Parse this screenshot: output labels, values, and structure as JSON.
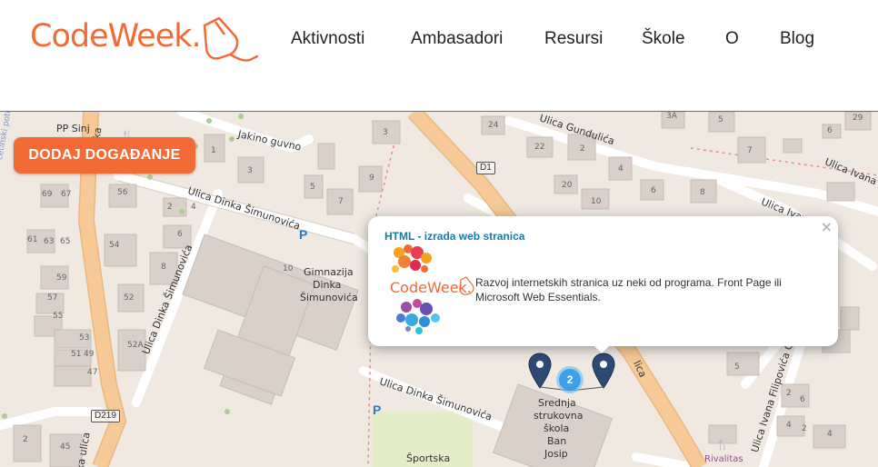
{
  "logo": {
    "text": "CodeWeek."
  },
  "nav": {
    "items": [
      {
        "label": "Aktivnosti"
      },
      {
        "label": "Ambasadori"
      },
      {
        "label": "Resursi"
      },
      {
        "label": "Škole"
      },
      {
        "label": "O"
      },
      {
        "label": "Blog"
      }
    ]
  },
  "map": {
    "add_event_button": "DODAJ DOGAĐANJE",
    "popup": {
      "title": "HTML - izrada web stranica",
      "description": "Razvoj internetskih stranica uz neki od programa. Front Page ili Microsoft Web Essentials.",
      "close": "×",
      "image_text": "CodeWeek."
    },
    "cluster_count": "2",
    "labels": {
      "pp_sinj": "PP Sinj",
      "jakino_guvno": "Jakino guvno",
      "gimnazija_1": "Gimnazija",
      "gimnazija_2": "Dinka",
      "gimnazija_3": "Šimunovića",
      "srednja_1": "Srednja",
      "srednja_2": "strukovna",
      "srednja_3": "škola",
      "srednja_4": "Ban",
      "srednja_5": "Josip",
      "sportska": "Športska",
      "rivalitas": "Rivalitas",
      "street_dinka_1": "Ulica Dinka Šimunovića",
      "street_dinka_2": "Ulica Dinka Šimunovića",
      "street_dinka_3": "Ulica Dinka Šimunovića",
      "street_dinka_vertical": "Ulica Dinka Šimunovića",
      "street_gundulica": "Ulica Gundulića",
      "street_ivana_a": "Ulica Ivana A",
      "street_ivana": "Ulica Ivan",
      "street_ivana_filipovica": "Ulica Ivana Filipovića Gr",
      "street_ka_ulica": "ka ulica",
      "street_rlicka": "rlička",
      "street_lica": "lica",
      "road_d1": "D1",
      "road_d219": "D219",
      "parking": "P",
      "cetinski_potok": "cetinski potok"
    },
    "house_numbers": [
      "3",
      "24",
      "3A",
      "5",
      "29",
      "22",
      "2",
      "7",
      "6",
      "1",
      "3",
      "5",
      "9",
      "7",
      "4",
      "20",
      "10",
      "6",
      "8",
      "56",
      "69",
      "67",
      "2",
      "4",
      "61",
      "63",
      "65",
      "54",
      "6",
      "8",
      "59",
      "57",
      "55",
      "52",
      "52A",
      "53",
      "51",
      "49",
      "47",
      "10",
      "2",
      "4",
      "5",
      "6",
      "2",
      "4",
      "45",
      "2"
    ]
  },
  "colors": {
    "brand_orange": "#f26b36",
    "link_blue": "#157ca3",
    "marker_blue": "#2d4a76",
    "cluster_blue": "#3ea0e6",
    "map_bg": "#efe9e1",
    "road_orange": "#f6c996"
  }
}
